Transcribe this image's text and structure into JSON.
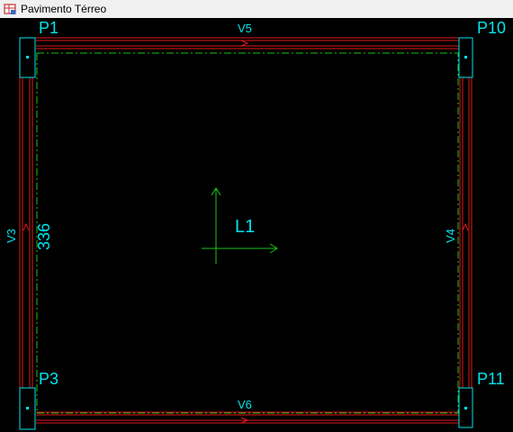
{
  "window": {
    "title": "Pavimento Térreo",
    "icon": "structure-app-icon"
  },
  "drawing": {
    "colors": {
      "background": "#000000",
      "labels": "#00e5ee",
      "beam_lines": "#e01818",
      "slab_outline": "#19c419",
      "axis": "#19c419"
    },
    "columns": [
      {
        "name": "P1"
      },
      {
        "name": "P10"
      },
      {
        "name": "P3"
      },
      {
        "name": "P11"
      }
    ],
    "beams": [
      {
        "name": "V5"
      },
      {
        "name": "V6"
      },
      {
        "name": "V3"
      },
      {
        "name": "V4"
      }
    ],
    "slab": {
      "name": "L1"
    },
    "dimension": {
      "value": "336"
    }
  }
}
